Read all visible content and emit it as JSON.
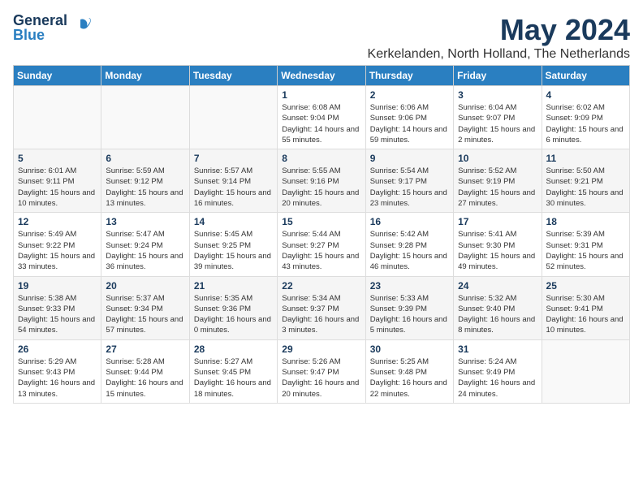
{
  "logo": {
    "general": "General",
    "blue": "Blue"
  },
  "title": "May 2024",
  "location": "Kerkelanden, North Holland, The Netherlands",
  "weekdays": [
    "Sunday",
    "Monday",
    "Tuesday",
    "Wednesday",
    "Thursday",
    "Friday",
    "Saturday"
  ],
  "weeks": [
    [
      {
        "day": "",
        "sunrise": "",
        "sunset": "",
        "daylight": ""
      },
      {
        "day": "",
        "sunrise": "",
        "sunset": "",
        "daylight": ""
      },
      {
        "day": "",
        "sunrise": "",
        "sunset": "",
        "daylight": ""
      },
      {
        "day": "1",
        "sunrise": "Sunrise: 6:08 AM",
        "sunset": "Sunset: 9:04 PM",
        "daylight": "Daylight: 14 hours and 55 minutes."
      },
      {
        "day": "2",
        "sunrise": "Sunrise: 6:06 AM",
        "sunset": "Sunset: 9:06 PM",
        "daylight": "Daylight: 14 hours and 59 minutes."
      },
      {
        "day": "3",
        "sunrise": "Sunrise: 6:04 AM",
        "sunset": "Sunset: 9:07 PM",
        "daylight": "Daylight: 15 hours and 2 minutes."
      },
      {
        "day": "4",
        "sunrise": "Sunrise: 6:02 AM",
        "sunset": "Sunset: 9:09 PM",
        "daylight": "Daylight: 15 hours and 6 minutes."
      }
    ],
    [
      {
        "day": "5",
        "sunrise": "Sunrise: 6:01 AM",
        "sunset": "Sunset: 9:11 PM",
        "daylight": "Daylight: 15 hours and 10 minutes."
      },
      {
        "day": "6",
        "sunrise": "Sunrise: 5:59 AM",
        "sunset": "Sunset: 9:12 PM",
        "daylight": "Daylight: 15 hours and 13 minutes."
      },
      {
        "day": "7",
        "sunrise": "Sunrise: 5:57 AM",
        "sunset": "Sunset: 9:14 PM",
        "daylight": "Daylight: 15 hours and 16 minutes."
      },
      {
        "day": "8",
        "sunrise": "Sunrise: 5:55 AM",
        "sunset": "Sunset: 9:16 PM",
        "daylight": "Daylight: 15 hours and 20 minutes."
      },
      {
        "day": "9",
        "sunrise": "Sunrise: 5:54 AM",
        "sunset": "Sunset: 9:17 PM",
        "daylight": "Daylight: 15 hours and 23 minutes."
      },
      {
        "day": "10",
        "sunrise": "Sunrise: 5:52 AM",
        "sunset": "Sunset: 9:19 PM",
        "daylight": "Daylight: 15 hours and 27 minutes."
      },
      {
        "day": "11",
        "sunrise": "Sunrise: 5:50 AM",
        "sunset": "Sunset: 9:21 PM",
        "daylight": "Daylight: 15 hours and 30 minutes."
      }
    ],
    [
      {
        "day": "12",
        "sunrise": "Sunrise: 5:49 AM",
        "sunset": "Sunset: 9:22 PM",
        "daylight": "Daylight: 15 hours and 33 minutes."
      },
      {
        "day": "13",
        "sunrise": "Sunrise: 5:47 AM",
        "sunset": "Sunset: 9:24 PM",
        "daylight": "Daylight: 15 hours and 36 minutes."
      },
      {
        "day": "14",
        "sunrise": "Sunrise: 5:45 AM",
        "sunset": "Sunset: 9:25 PM",
        "daylight": "Daylight: 15 hours and 39 minutes."
      },
      {
        "day": "15",
        "sunrise": "Sunrise: 5:44 AM",
        "sunset": "Sunset: 9:27 PM",
        "daylight": "Daylight: 15 hours and 43 minutes."
      },
      {
        "day": "16",
        "sunrise": "Sunrise: 5:42 AM",
        "sunset": "Sunset: 9:28 PM",
        "daylight": "Daylight: 15 hours and 46 minutes."
      },
      {
        "day": "17",
        "sunrise": "Sunrise: 5:41 AM",
        "sunset": "Sunset: 9:30 PM",
        "daylight": "Daylight: 15 hours and 49 minutes."
      },
      {
        "day": "18",
        "sunrise": "Sunrise: 5:39 AM",
        "sunset": "Sunset: 9:31 PM",
        "daylight": "Daylight: 15 hours and 52 minutes."
      }
    ],
    [
      {
        "day": "19",
        "sunrise": "Sunrise: 5:38 AM",
        "sunset": "Sunset: 9:33 PM",
        "daylight": "Daylight: 15 hours and 54 minutes."
      },
      {
        "day": "20",
        "sunrise": "Sunrise: 5:37 AM",
        "sunset": "Sunset: 9:34 PM",
        "daylight": "Daylight: 15 hours and 57 minutes."
      },
      {
        "day": "21",
        "sunrise": "Sunrise: 5:35 AM",
        "sunset": "Sunset: 9:36 PM",
        "daylight": "Daylight: 16 hours and 0 minutes."
      },
      {
        "day": "22",
        "sunrise": "Sunrise: 5:34 AM",
        "sunset": "Sunset: 9:37 PM",
        "daylight": "Daylight: 16 hours and 3 minutes."
      },
      {
        "day": "23",
        "sunrise": "Sunrise: 5:33 AM",
        "sunset": "Sunset: 9:39 PM",
        "daylight": "Daylight: 16 hours and 5 minutes."
      },
      {
        "day": "24",
        "sunrise": "Sunrise: 5:32 AM",
        "sunset": "Sunset: 9:40 PM",
        "daylight": "Daylight: 16 hours and 8 minutes."
      },
      {
        "day": "25",
        "sunrise": "Sunrise: 5:30 AM",
        "sunset": "Sunset: 9:41 PM",
        "daylight": "Daylight: 16 hours and 10 minutes."
      }
    ],
    [
      {
        "day": "26",
        "sunrise": "Sunrise: 5:29 AM",
        "sunset": "Sunset: 9:43 PM",
        "daylight": "Daylight: 16 hours and 13 minutes."
      },
      {
        "day": "27",
        "sunrise": "Sunrise: 5:28 AM",
        "sunset": "Sunset: 9:44 PM",
        "daylight": "Daylight: 16 hours and 15 minutes."
      },
      {
        "day": "28",
        "sunrise": "Sunrise: 5:27 AM",
        "sunset": "Sunset: 9:45 PM",
        "daylight": "Daylight: 16 hours and 18 minutes."
      },
      {
        "day": "29",
        "sunrise": "Sunrise: 5:26 AM",
        "sunset": "Sunset: 9:47 PM",
        "daylight": "Daylight: 16 hours and 20 minutes."
      },
      {
        "day": "30",
        "sunrise": "Sunrise: 5:25 AM",
        "sunset": "Sunset: 9:48 PM",
        "daylight": "Daylight: 16 hours and 22 minutes."
      },
      {
        "day": "31",
        "sunrise": "Sunrise: 5:24 AM",
        "sunset": "Sunset: 9:49 PM",
        "daylight": "Daylight: 16 hours and 24 minutes."
      },
      {
        "day": "",
        "sunrise": "",
        "sunset": "",
        "daylight": ""
      }
    ]
  ]
}
